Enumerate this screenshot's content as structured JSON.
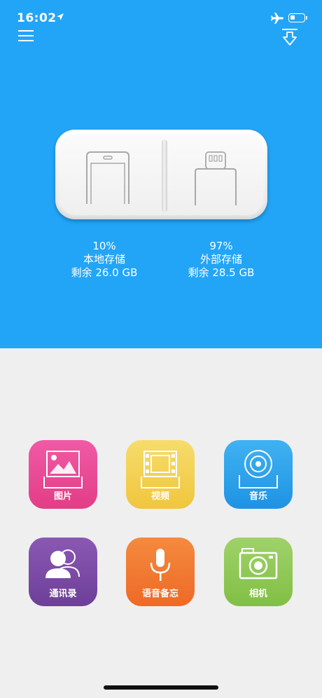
{
  "status": {
    "time": "16:02",
    "icons": [
      "location-arrow-icon",
      "airplane-icon",
      "battery-icon"
    ]
  },
  "header": {
    "menu_icon": "hamburger-menu-icon",
    "download_icon": "download-icon"
  },
  "colors": {
    "hero_bg": "#23a5f7",
    "page_bg": "#efeff0"
  },
  "storage": {
    "local": {
      "percent": "10%",
      "label": "本地存储",
      "remaining": "剩余 26.0 GB"
    },
    "external": {
      "percent": "97%",
      "label": "外部存储",
      "remaining": "剩余 28.5 GB"
    }
  },
  "tiles": [
    {
      "label": "图片",
      "icon": "photo-icon",
      "color": "#e9489a"
    },
    {
      "label": "视频",
      "icon": "film-icon",
      "color": "#f3d150"
    },
    {
      "label": "音乐",
      "icon": "disc-icon",
      "color": "#2ea3ea"
    },
    {
      "label": "通讯录",
      "icon": "contacts-icon",
      "color": "#7b4aa5"
    },
    {
      "label": "语音备忘",
      "icon": "microphone-icon",
      "color": "#f07a30"
    },
    {
      "label": "相机",
      "icon": "camera-icon",
      "color": "#90c956"
    }
  ]
}
